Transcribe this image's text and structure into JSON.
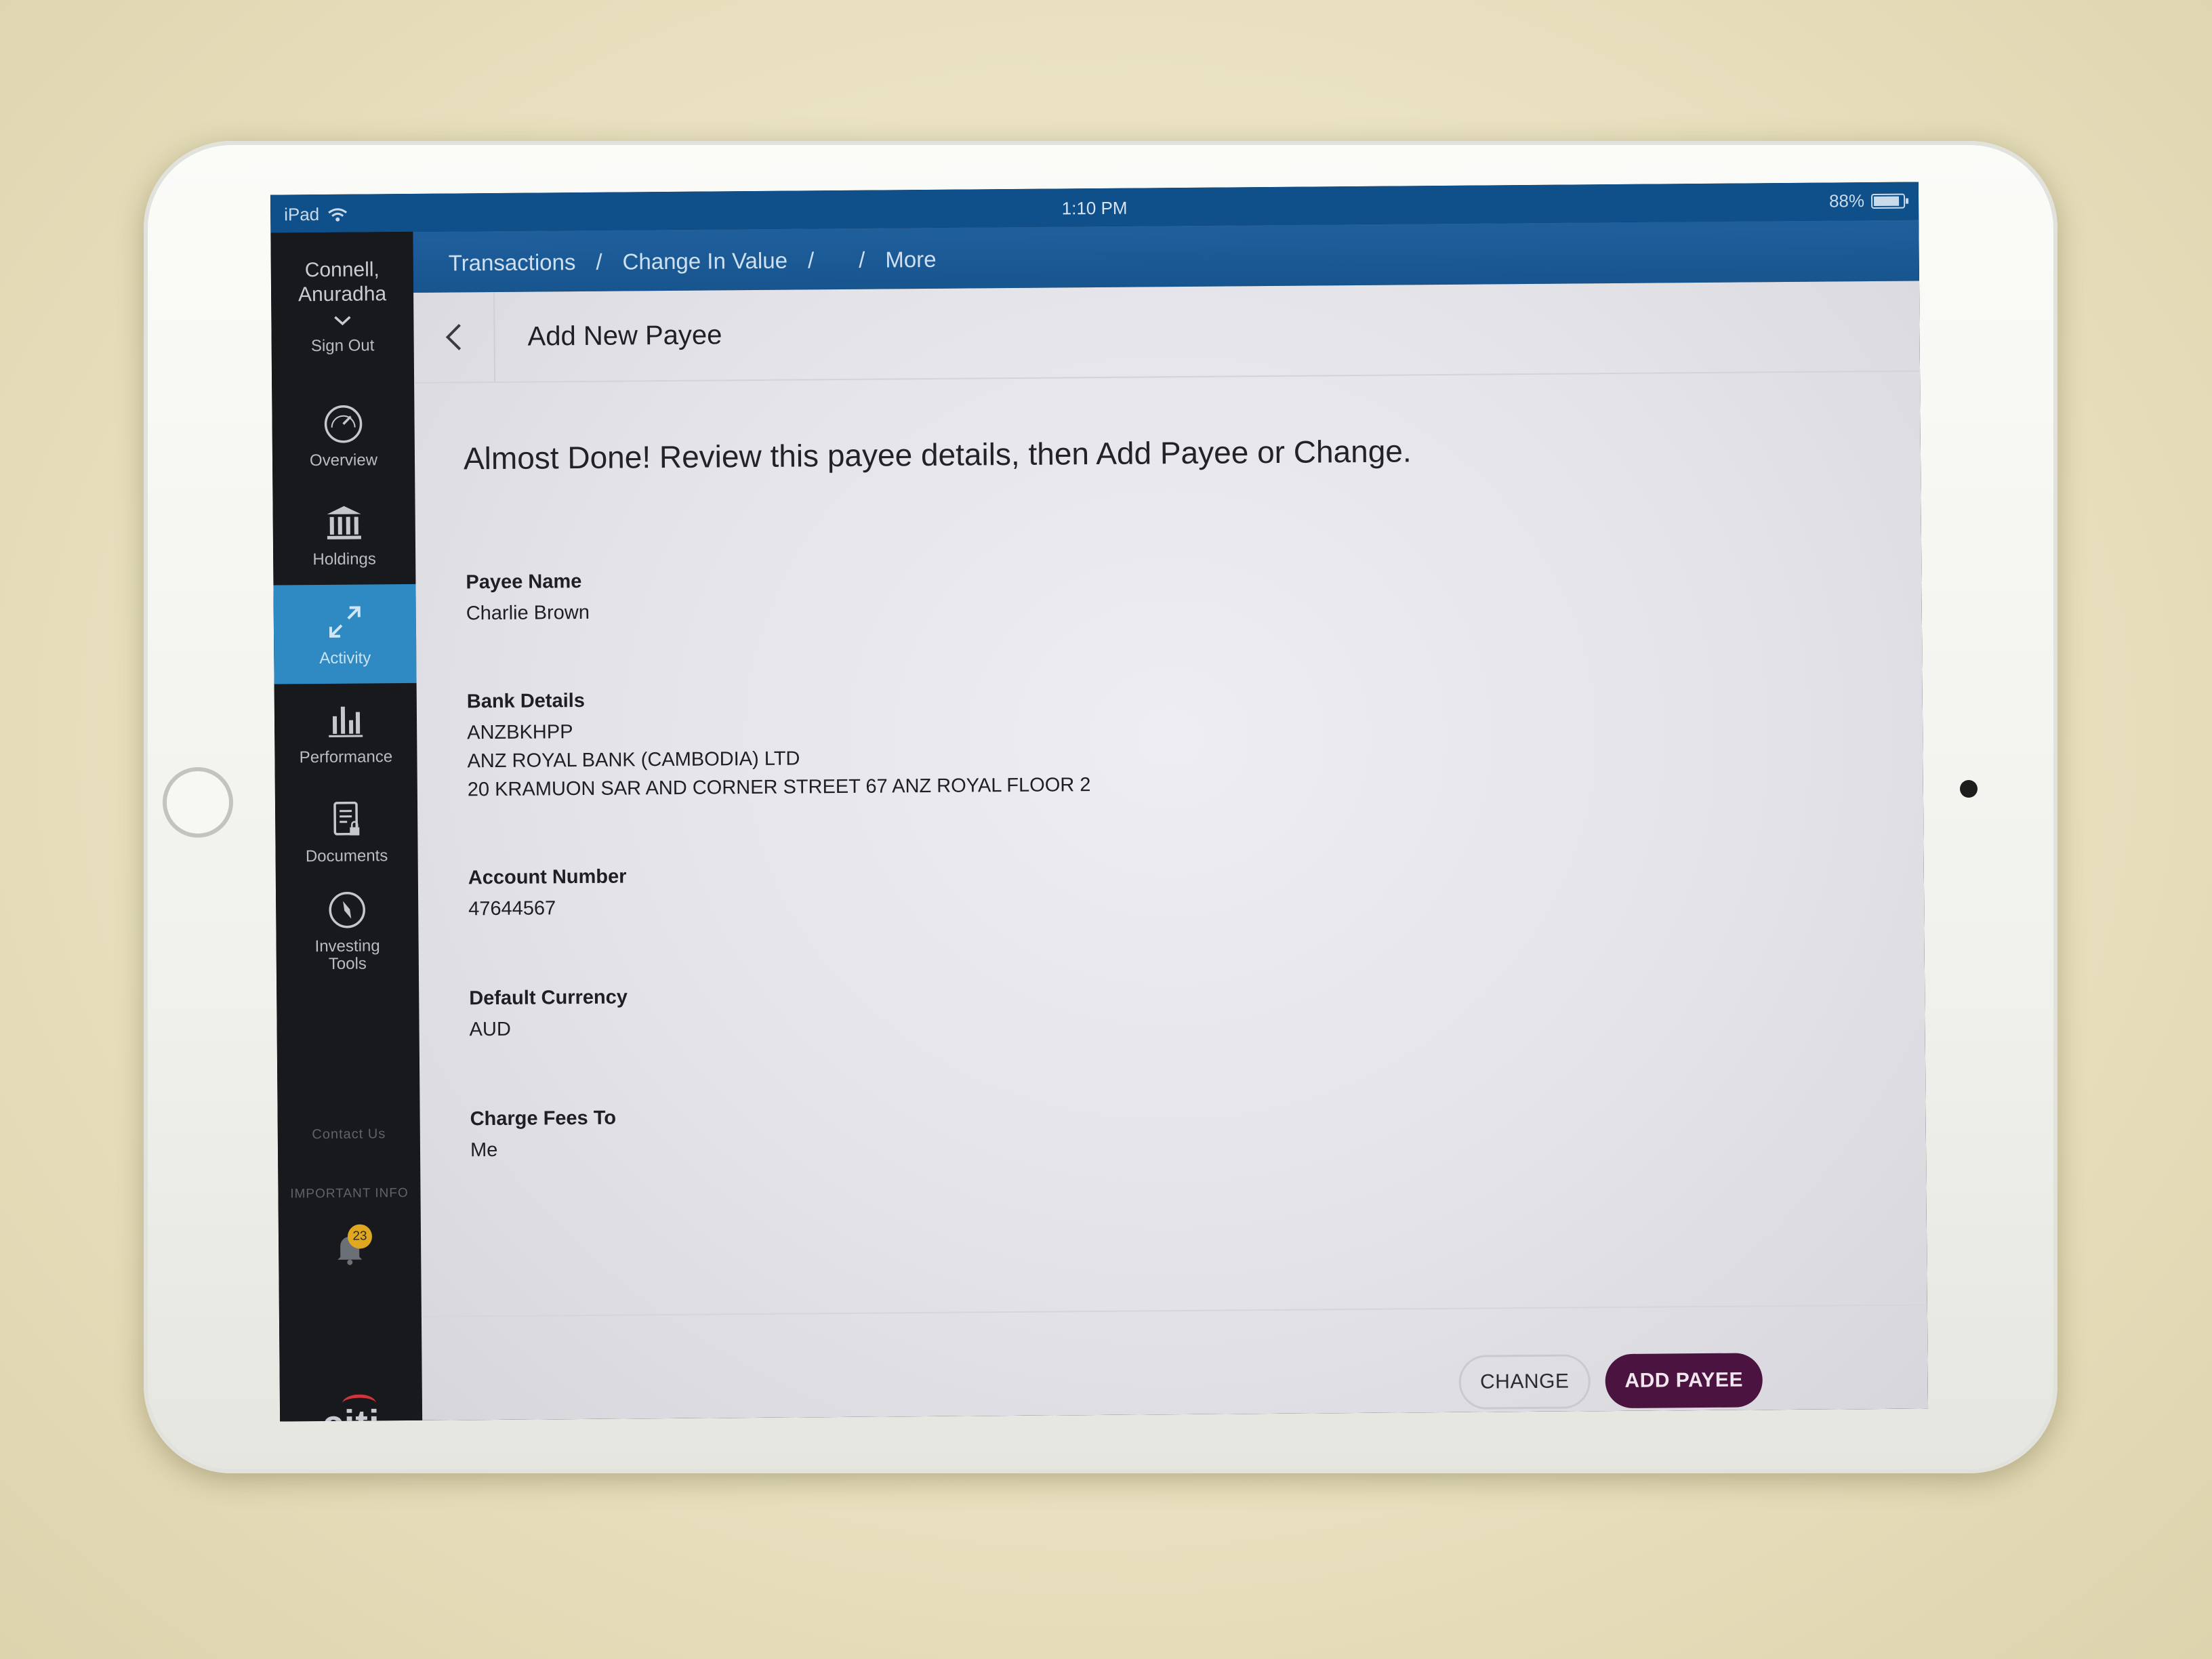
{
  "status_bar": {
    "device": "iPad",
    "time": "1:10 PM",
    "battery": "88%",
    "battery_level": 0.88
  },
  "sidebar": {
    "user_name": "Connell, Anuradha",
    "sign_out": "Sign Out",
    "items": [
      {
        "label": "Overview",
        "icon": "speedometer-icon"
      },
      {
        "label": "Holdings",
        "icon": "bank-icon"
      },
      {
        "label": "Activity",
        "icon": "arrows-icon",
        "active": true
      },
      {
        "label": "Performance",
        "icon": "bar-chart-icon"
      },
      {
        "label": "Documents",
        "icon": "document-lock-icon"
      },
      {
        "label": "Investing Tools",
        "icon": "compass-icon"
      }
    ],
    "contact_us": "Contact Us",
    "important_info": "IMPORTANT INFO",
    "notifications_badge": "23",
    "logo": "citi"
  },
  "topnav": {
    "crumbs": [
      "Transactions",
      "Change In Value",
      "",
      "More"
    ],
    "separator": "/"
  },
  "page": {
    "title": "Add New Payee",
    "instruction": "Almost Done! Review this payee details, then Add Payee or Change.",
    "fields": [
      {
        "label": "Payee Name",
        "value": [
          "Charlie Brown"
        ]
      },
      {
        "label": "Bank Details",
        "value": [
          "ANZBKHPP",
          "ANZ ROYAL BANK (CAMBODIA) LTD",
          "20 KRAMUON SAR AND CORNER STREET 67 ANZ ROYAL FLOOR 2"
        ]
      },
      {
        "label": "Account Number",
        "value": [
          "47644567"
        ]
      },
      {
        "label": "Default Currency",
        "value": [
          "AUD"
        ]
      },
      {
        "label": "Charge Fees To",
        "value": [
          "Me"
        ]
      }
    ],
    "buttons": {
      "change": "CHANGE",
      "add_payee": "ADD PAYEE"
    }
  },
  "colors": {
    "nav_blue": "#18558f",
    "sidebar_bg": "#18191c",
    "active_item": "#2f89c3",
    "primary_button": "#4a1340",
    "badge": "#e0a820",
    "logo_arc": "#d1343c"
  }
}
